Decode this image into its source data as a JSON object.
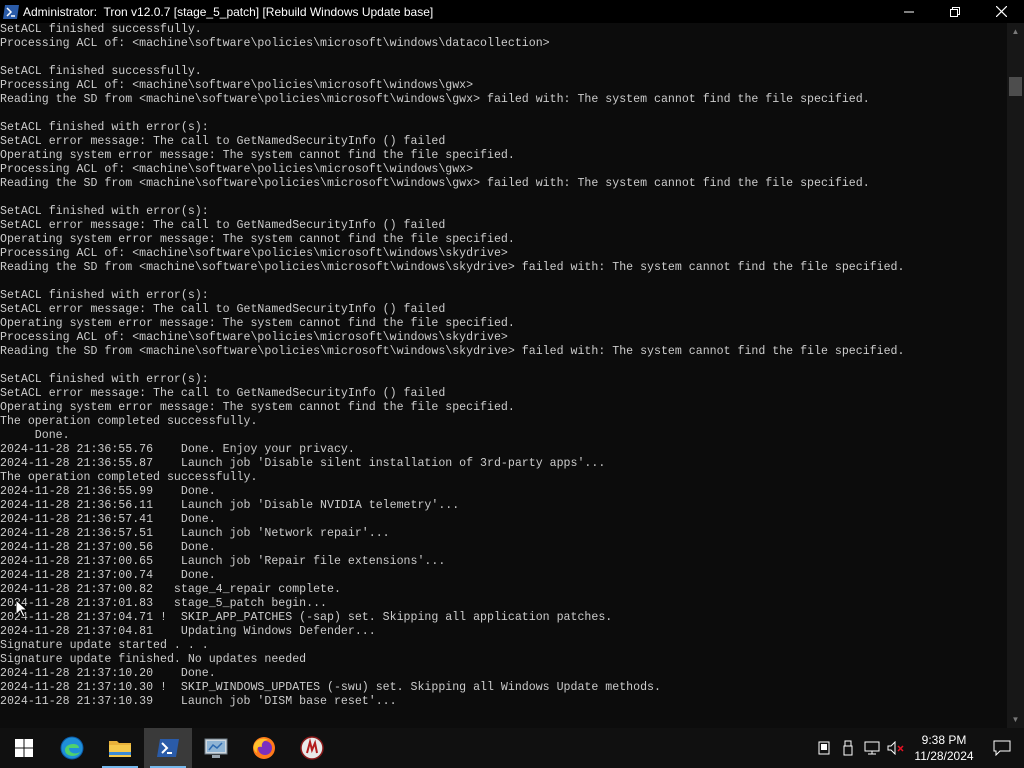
{
  "window": {
    "title": "Administrator:  Tron v12.0.7 [stage_5_patch] [Rebuild Windows Update base]",
    "minimize_glyph": "—",
    "maximize_glyph": "❐",
    "close_glyph": "✕"
  },
  "console": {
    "output": "SetACL finished successfully.\nProcessing ACL of: <machine\\software\\policies\\microsoft\\windows\\datacollection>\n\nSetACL finished successfully.\nProcessing ACL of: <machine\\software\\policies\\microsoft\\windows\\gwx>\nReading the SD from <machine\\software\\policies\\microsoft\\windows\\gwx> failed with: The system cannot find the file specified.\n\nSetACL finished with error(s):\nSetACL error message: The call to GetNamedSecurityInfo () failed\nOperating system error message: The system cannot find the file specified.\nProcessing ACL of: <machine\\software\\policies\\microsoft\\windows\\gwx>\nReading the SD from <machine\\software\\policies\\microsoft\\windows\\gwx> failed with: The system cannot find the file specified.\n\nSetACL finished with error(s):\nSetACL error message: The call to GetNamedSecurityInfo () failed\nOperating system error message: The system cannot find the file specified.\nProcessing ACL of: <machine\\software\\policies\\microsoft\\windows\\skydrive>\nReading the SD from <machine\\software\\policies\\microsoft\\windows\\skydrive> failed with: The system cannot find the file specified.\n\nSetACL finished with error(s):\nSetACL error message: The call to GetNamedSecurityInfo () failed\nOperating system error message: The system cannot find the file specified.\nProcessing ACL of: <machine\\software\\policies\\microsoft\\windows\\skydrive>\nReading the SD from <machine\\software\\policies\\microsoft\\windows\\skydrive> failed with: The system cannot find the file specified.\n\nSetACL finished with error(s):\nSetACL error message: The call to GetNamedSecurityInfo () failed\nOperating system error message: The system cannot find the file specified.\nThe operation completed successfully.\n     Done.\n2024-11-28 21:36:55.76    Done. Enjoy your privacy.\n2024-11-28 21:36:55.87    Launch job 'Disable silent installation of 3rd-party apps'...\nThe operation completed successfully.\n2024-11-28 21:36:55.99    Done.\n2024-11-28 21:36:56.11    Launch job 'Disable NVIDIA telemetry'...\n2024-11-28 21:36:57.41    Done.\n2024-11-28 21:36:57.51    Launch job 'Network repair'...\n2024-11-28 21:37:00.56    Done.\n2024-11-28 21:37:00.65    Launch job 'Repair file extensions'...\n2024-11-28 21:37:00.74    Done.\n2024-11-28 21:37:00.82   stage_4_repair complete.\n2024-11-28 21:37:01.83   stage_5_patch begin...\n2024-11-28 21:37:04.71 !  SKIP_APP_PATCHES (-sap) set. Skipping all application patches.\n2024-11-28 21:37:04.81    Updating Windows Defender...\nSignature update started . . .\nSignature update finished. No updates needed\n2024-11-28 21:37:10.20    Done.\n2024-11-28 21:37:10.30 !  SKIP_WINDOWS_UPDATES (-swu) set. Skipping all Windows Update methods.\n2024-11-28 21:37:10.39    Launch job 'DISM base reset'..."
  },
  "taskbar": {
    "items": [
      {
        "icon": "windows-start-icon"
      },
      {
        "icon": "edge-icon"
      },
      {
        "icon": "file-explorer-icon"
      },
      {
        "icon": "powershell-icon"
      },
      {
        "icon": "control-panel-icon"
      },
      {
        "icon": "firefox-icon"
      },
      {
        "icon": "tron-icon"
      }
    ],
    "tray": {
      "time": "9:38 PM",
      "date": "11/28/2024",
      "icons": [
        "tablet-icon",
        "usb-eject-icon",
        "network-icon",
        "volume-muted-icon",
        "notification-icon"
      ]
    }
  },
  "colors": {
    "console_bg": "#0c0c0c",
    "console_fg": "#cccccc",
    "taskbar_bg": "#101010",
    "accent": "#76b9ed"
  }
}
